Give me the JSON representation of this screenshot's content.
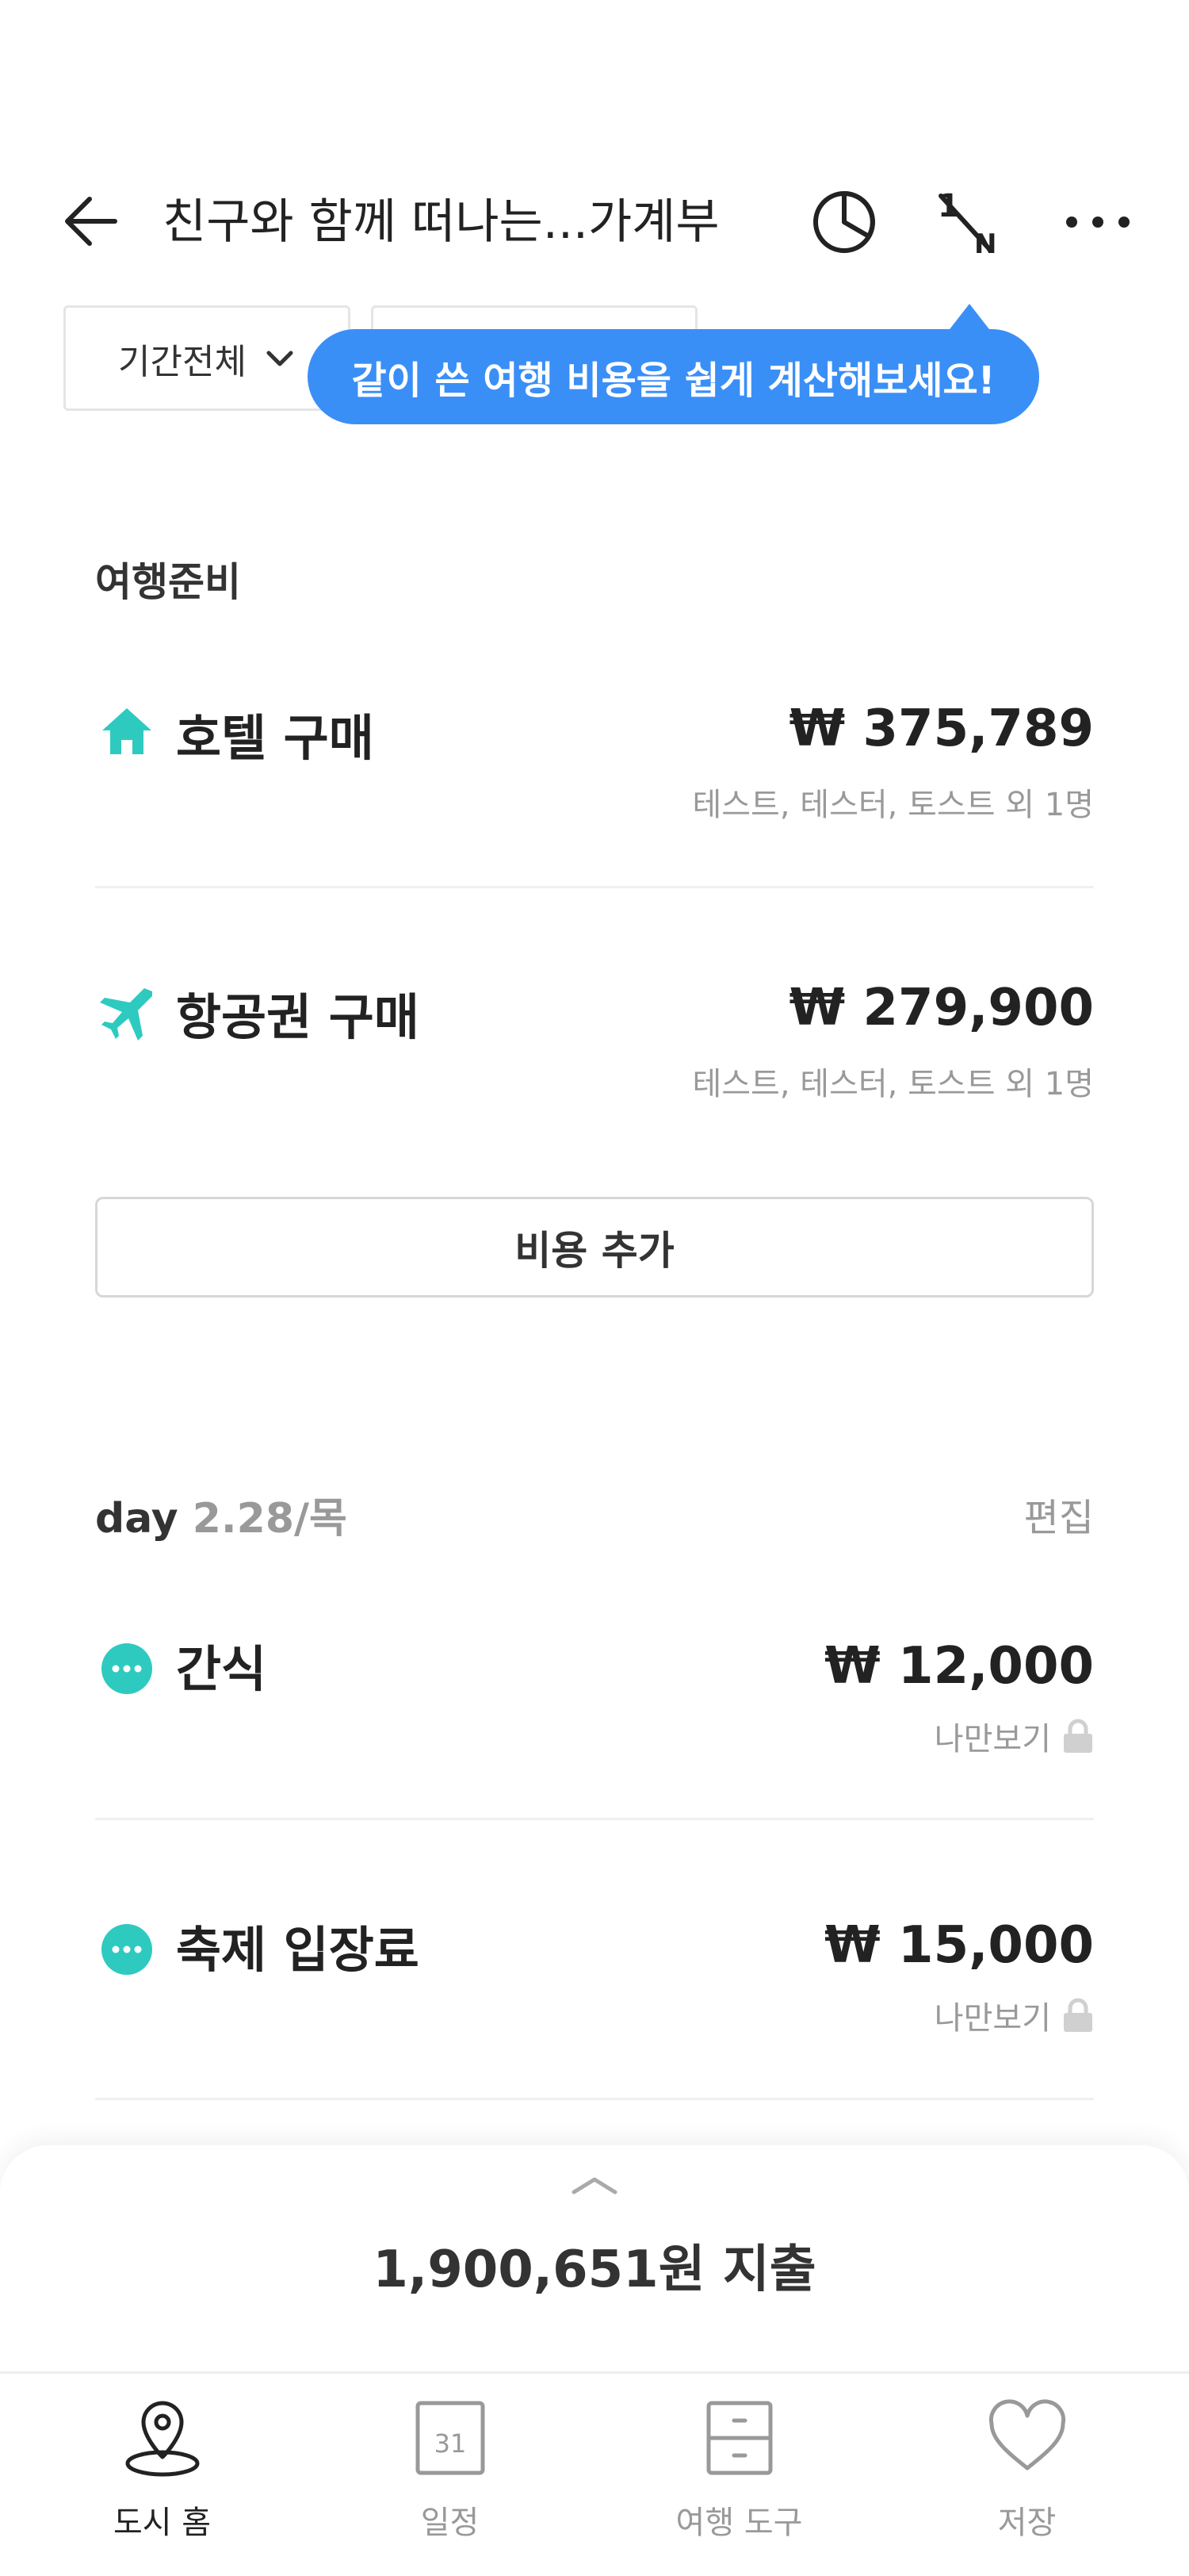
{
  "header": {
    "title": "친구와 함께 떠나는...가계부",
    "split_icon_numerator": "1",
    "split_icon_denominator": "N"
  },
  "filter": {
    "period_label": "기간전체"
  },
  "tooltip": {
    "text": "같이 쓴 여행 비용을 쉽게 계산해보세요!"
  },
  "sections": {
    "prep": {
      "label": "여행준비",
      "items": [
        {
          "name": "호텔 구매",
          "icon": "house-icon",
          "amount": "₩ 375,789",
          "sub": "테스트, 테스터, 토스트 외 1명"
        },
        {
          "name": "항공권 구매",
          "icon": "airplane-icon",
          "amount": "₩ 279,900",
          "sub": "테스트, 테스터, 토스트 외 1명"
        }
      ],
      "add_label": "비용 추가"
    },
    "day": {
      "prefix": "day",
      "date": "2.28/목",
      "edit_label": "편집",
      "items": [
        {
          "name": "간식",
          "icon": "more-dots-icon",
          "amount": "₩ 12,000",
          "sub": "나만보기"
        },
        {
          "name": "축제 입장료",
          "icon": "more-dots-icon",
          "amount": "₩ 15,000",
          "sub": "나만보기"
        }
      ]
    }
  },
  "summary": {
    "total_text": "1,900,651원 지출"
  },
  "nav": {
    "items": [
      {
        "label": "도시 홈",
        "icon": "map-pin-icon",
        "active": true
      },
      {
        "label": "일정",
        "icon": "calendar-icon",
        "calendar_day": "31",
        "active": false
      },
      {
        "label": "여행 도구",
        "icon": "cabinet-icon",
        "active": false
      },
      {
        "label": "저장",
        "icon": "heart-icon",
        "active": false
      }
    ]
  },
  "colors": {
    "accent": "#2ecac0",
    "tooltip": "#3a8ff7",
    "muted": "#999999"
  }
}
